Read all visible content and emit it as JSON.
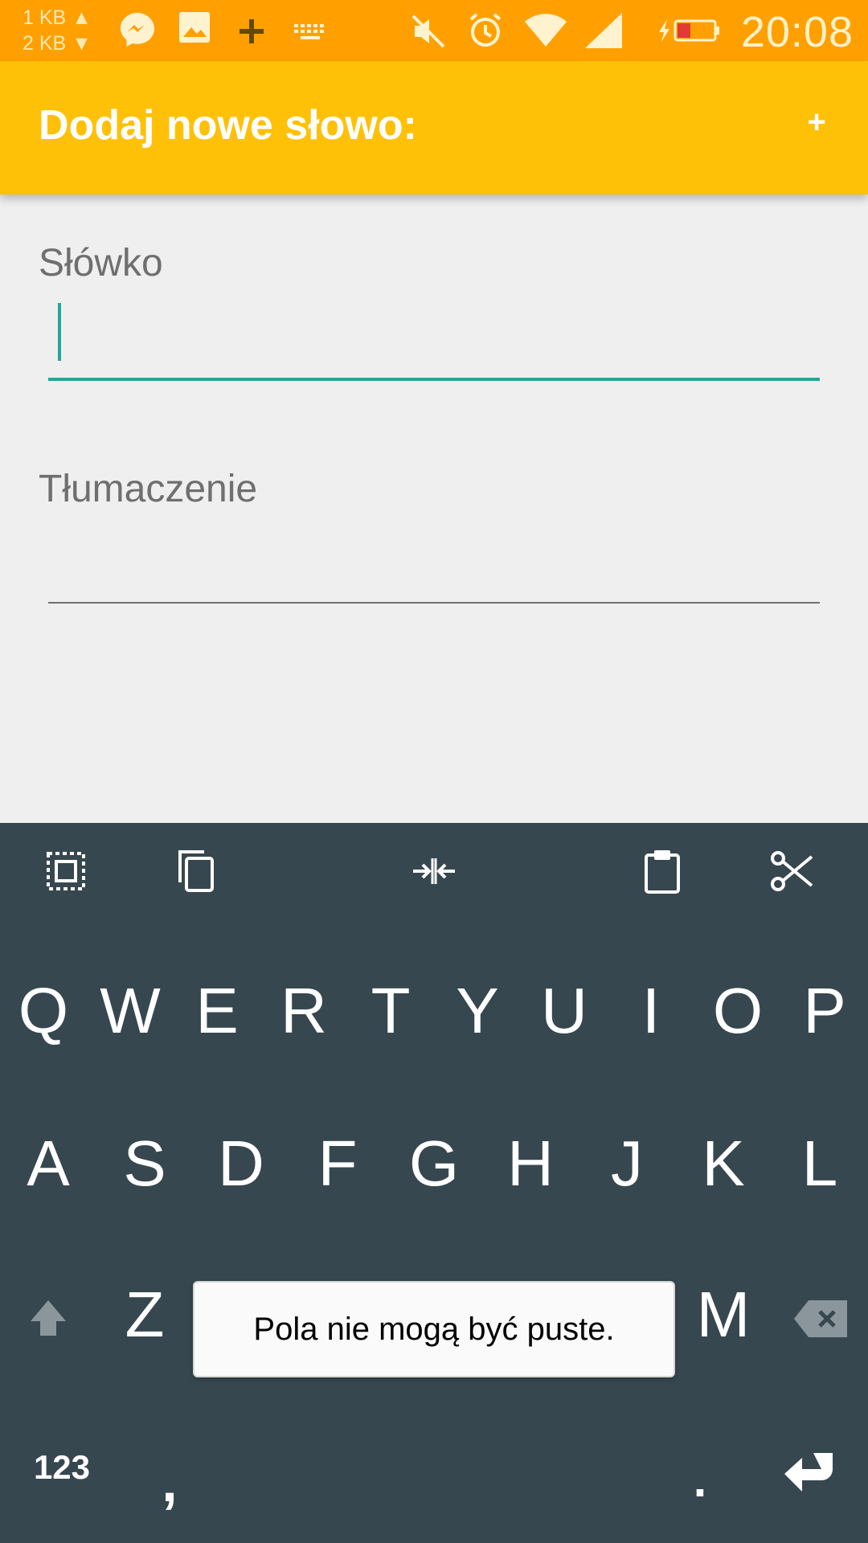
{
  "status_bar": {
    "speed_up": "1 KB ▲",
    "speed_down": "2 KB ▼",
    "time": "20:08",
    "icons": [
      "messenger-icon",
      "image-icon",
      "plus-icon",
      "keyboard-icon",
      "mute-icon",
      "alarm-icon",
      "wifi-icon",
      "signal-icon",
      "battery-charging-icon"
    ]
  },
  "appbar": {
    "title": "Dodaj nowe słowo:",
    "add_label": "+"
  },
  "form": {
    "word_label": "Słówko",
    "word_value": "",
    "translation_label": "Tłumaczenie",
    "translation_value": "",
    "focus_color": "#26a69a"
  },
  "keyboard": {
    "toolbar": [
      "select-all-icon",
      "copy-icon",
      "expand-selection-icon",
      "paste-icon",
      "cut-icon"
    ],
    "row1": [
      "Q",
      "W",
      "E",
      "R",
      "T",
      "Y",
      "U",
      "I",
      "O",
      "P"
    ],
    "row2": [
      "A",
      "S",
      "D",
      "F",
      "G",
      "H",
      "J",
      "K",
      "L"
    ],
    "row3": [
      "Z",
      "M"
    ],
    "symbols_label": "123",
    "comma": ",",
    "period": "."
  },
  "toast": {
    "message": "Pola nie mogą być puste."
  },
  "colors": {
    "status_bar": "#ffa000",
    "app_bar": "#ffc107",
    "keyboard_bg": "#37474f"
  }
}
